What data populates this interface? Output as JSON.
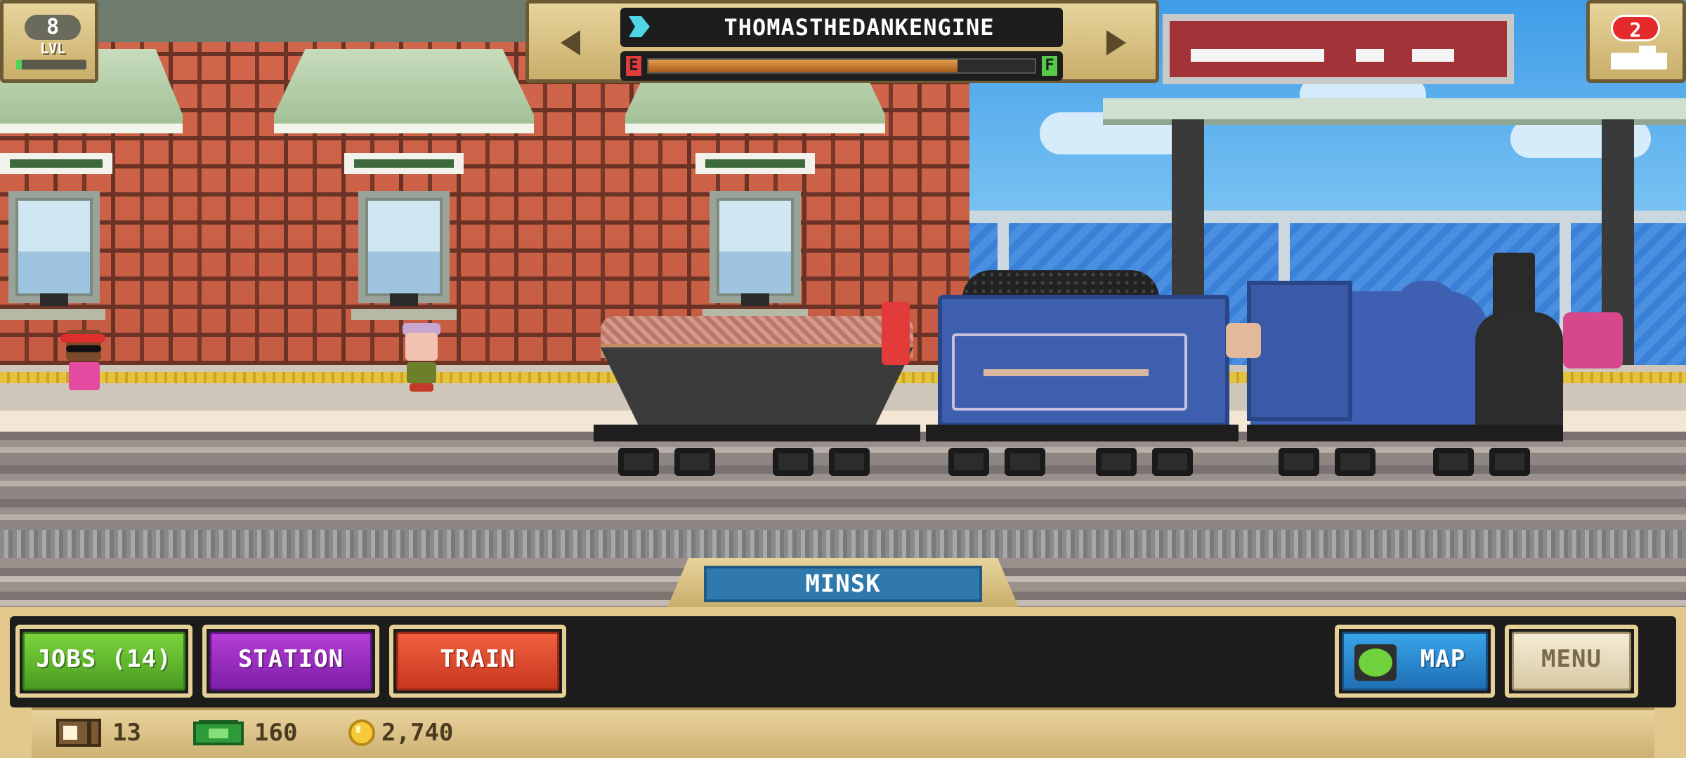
{
  "hud": {
    "level": {
      "number": "8",
      "label": "LVL",
      "progress": 0.08
    },
    "train_selector": {
      "train_name": "THOMASTHEDANKENGINE",
      "fuel": {
        "empty_label": "E",
        "full_label": "F",
        "level": 0.8
      }
    },
    "notifications": {
      "count": "2"
    },
    "location": {
      "name": "MINSK"
    }
  },
  "bottom_bar": {
    "buttons": {
      "jobs": "JOBS (14)",
      "station": "STATION",
      "train": "TRAIN",
      "map": "MAP",
      "menu": "MENU"
    },
    "colors": {
      "jobs": "#5fb52d",
      "station": "#9b2fc2",
      "train": "#e0472a",
      "map": "#2a86cc"
    }
  },
  "stats": {
    "crates": "13",
    "cash": "160",
    "coins": "2,740"
  },
  "icons": [
    "level-badge",
    "train-icon",
    "left-arrow-icon",
    "right-arrow-icon",
    "train-silhouette-icon",
    "map-icon",
    "crate-icon",
    "cash-icon",
    "coin-icon"
  ]
}
